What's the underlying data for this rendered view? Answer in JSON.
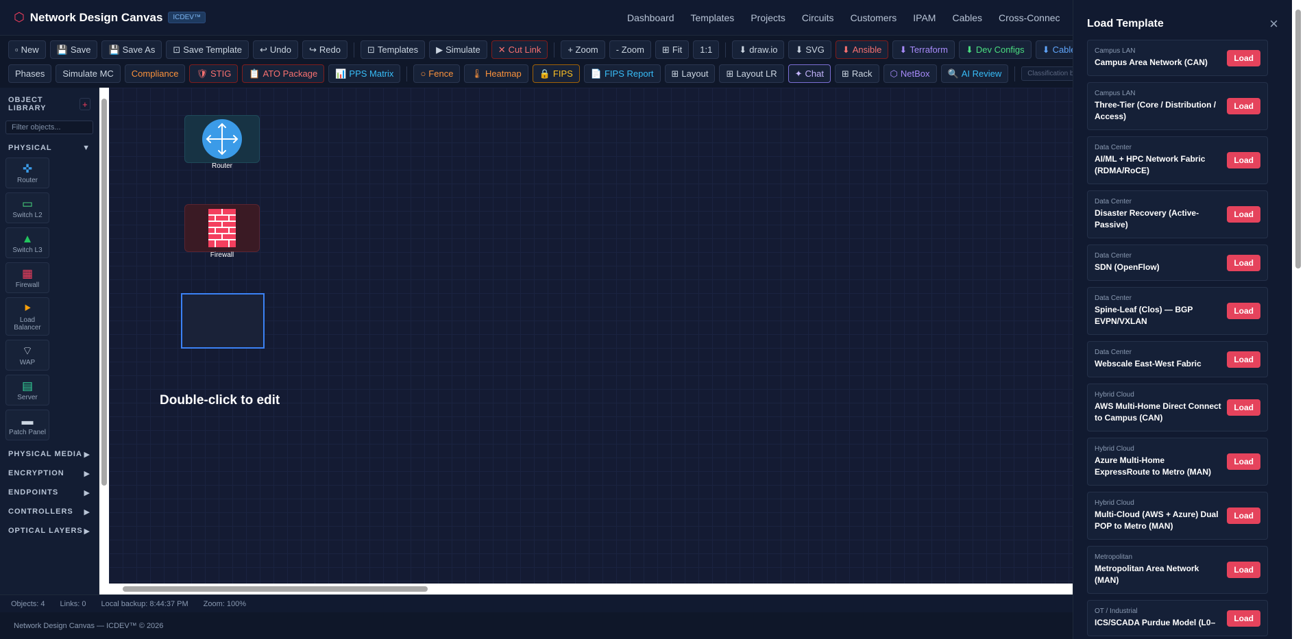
{
  "header": {
    "title": "Network Design Canvas",
    "badge": "ICDEV™",
    "nav": [
      "Dashboard",
      "Templates",
      "Projects",
      "Circuits",
      "Customers",
      "IPAM",
      "Cables",
      "Cross-Connec"
    ]
  },
  "toolbar1": {
    "new": "New",
    "save": "Save",
    "save_as": "Save As",
    "save_template": "Save Template",
    "undo": "Undo",
    "redo": "Redo",
    "templates": "Templates",
    "simulate": "Simulate",
    "cut_link": "Cut Link",
    "zoom_in": "+ Zoom",
    "zoom_out": "- Zoom",
    "fit": "Fit",
    "one_to_one": "1:1",
    "drawio": "draw.io",
    "svg": "SVG",
    "ansible": "Ansible",
    "terraform": "Terraform",
    "dev_configs": "Dev Configs",
    "cable_plant": "Cable Plant"
  },
  "toolbar2": {
    "phases": "Phases",
    "simulate_mc": "Simulate MC",
    "compliance": "Compliance",
    "stig": "STIG",
    "ato_package": "ATO Package",
    "pps_matrix": "PPS Matrix",
    "fence": "Fence",
    "heatmap": "Heatmap",
    "fips": "FIPS",
    "fips_report": "FIPS Report",
    "layout": "Layout",
    "layout_lr": "Layout LR",
    "chat": "Chat",
    "rack": "Rack",
    "netbox": "NetBox",
    "ai_review": "AI Review",
    "classification_placeholder": "Classification banner..."
  },
  "sidebar": {
    "title": "OBJECT LIBRARY",
    "add": "+",
    "filter_placeholder": "Filter objects...",
    "physical": "PHYSICAL",
    "items": [
      {
        "label": "Router",
        "icon": "router-icon"
      },
      {
        "label": "Switch L2",
        "icon": "switch-l2-icon"
      },
      {
        "label": "Switch L3",
        "icon": "switch-l3-icon"
      },
      {
        "label": "Firewall",
        "icon": "firewall-icon"
      },
      {
        "label": "Load Balancer",
        "icon": "load-balancer-icon"
      },
      {
        "label": "WAP",
        "icon": "wap-icon"
      },
      {
        "label": "Server",
        "icon": "server-icon"
      },
      {
        "label": "Patch Panel",
        "icon": "patch-panel-icon"
      }
    ],
    "sections": [
      "PHYSICAL MEDIA",
      "ENCRYPTION",
      "ENDPOINTS",
      "CONTROLLERS",
      "OPTICAL LAYERS"
    ]
  },
  "canvas": {
    "router_label": "Router",
    "firewall_label": "Firewall",
    "hint": "Double-click to edit"
  },
  "status": {
    "objects": "Objects: 4",
    "links": "Links: 0",
    "backup": "Local backup: 8:44:37 PM",
    "zoom": "Zoom: 100%"
  },
  "footer": {
    "text": "Network Design Canvas — ICDEV™ © 2026"
  },
  "panel": {
    "title": "Load Template",
    "close": "×",
    "load_label": "Load",
    "templates": [
      {
        "category": "Campus LAN",
        "name": "Campus Area Network (CAN)"
      },
      {
        "category": "Campus LAN",
        "name": "Three-Tier (Core / Distribution / Access)"
      },
      {
        "category": "Data Center",
        "name": "AI/ML + HPC Network Fabric (RDMA/RoCE)"
      },
      {
        "category": "Data Center",
        "name": "Disaster Recovery (Active-Passive)"
      },
      {
        "category": "Data Center",
        "name": "SDN (OpenFlow)"
      },
      {
        "category": "Data Center",
        "name": "Spine-Leaf (Clos) — BGP EVPN/VXLAN"
      },
      {
        "category": "Data Center",
        "name": "Webscale East-West Fabric"
      },
      {
        "category": "Hybrid Cloud",
        "name": "AWS Multi-Home Direct Connect to Campus (CAN)"
      },
      {
        "category": "Hybrid Cloud",
        "name": "Azure Multi-Home ExpressRoute to Metro (MAN)"
      },
      {
        "category": "Hybrid Cloud",
        "name": "Multi-Cloud (AWS + Azure) Dual POP to Metro (MAN)"
      },
      {
        "category": "Metropolitan",
        "name": "Metropolitan Area Network (MAN)"
      },
      {
        "category": "OT / Industrial",
        "name": "ICS/SCADA Purdue Model (L0–"
      }
    ]
  }
}
